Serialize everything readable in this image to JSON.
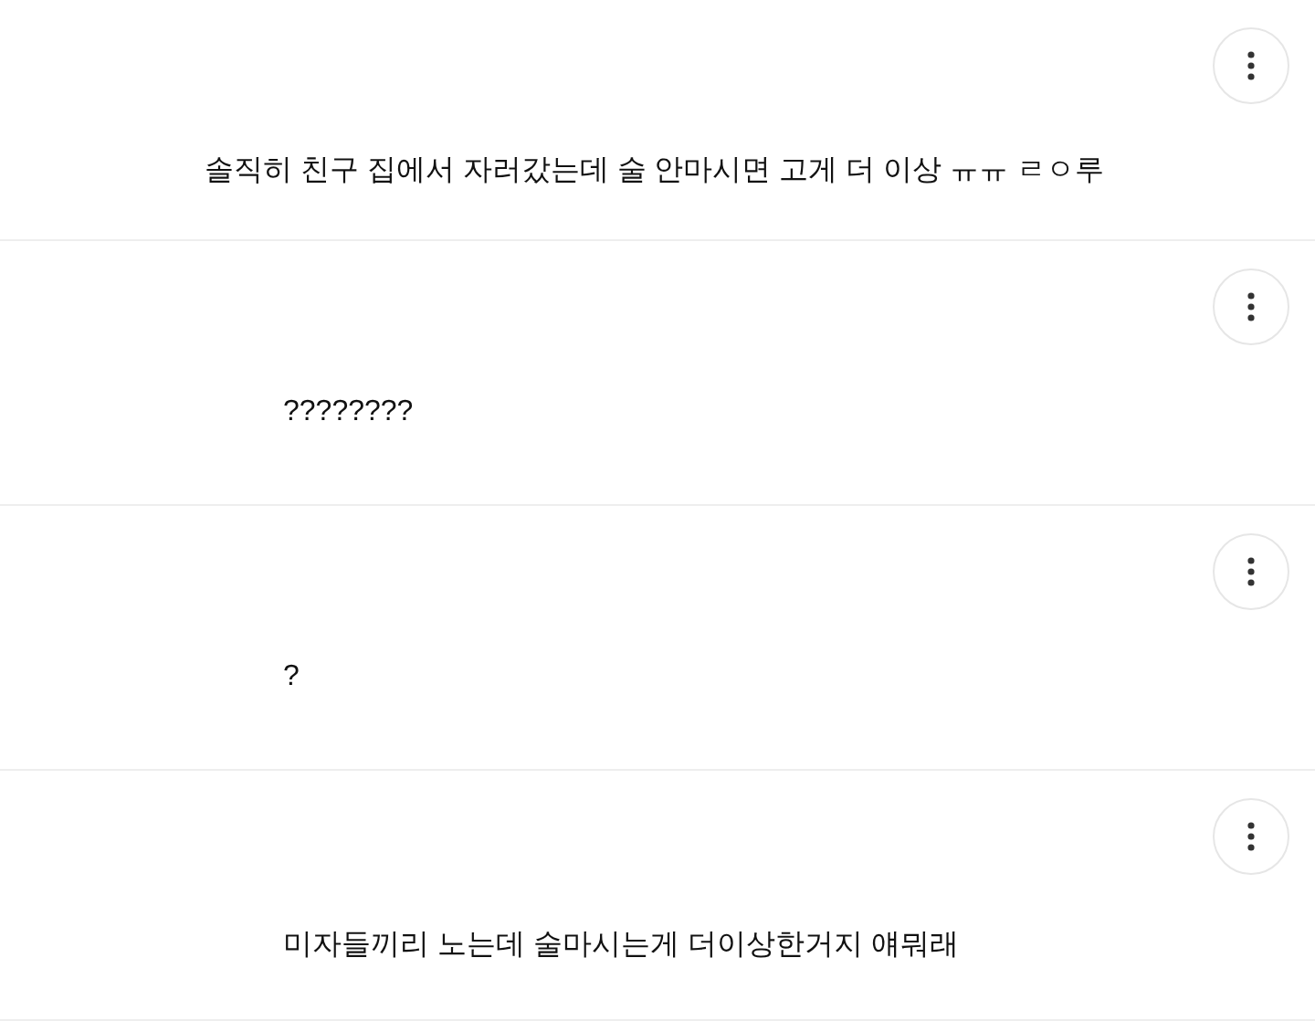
{
  "comments": [
    {
      "text": "솔직히 친구 집에서 자러갔는데 술 안마시면 고게 더 이상 ㅠㅠ ㄹㅇ루"
    },
    {
      "text": "????????"
    },
    {
      "text": "?"
    },
    {
      "text": "미자들끼리 노는데 술마시는게 더이상한거지 얘뭐래"
    }
  ]
}
